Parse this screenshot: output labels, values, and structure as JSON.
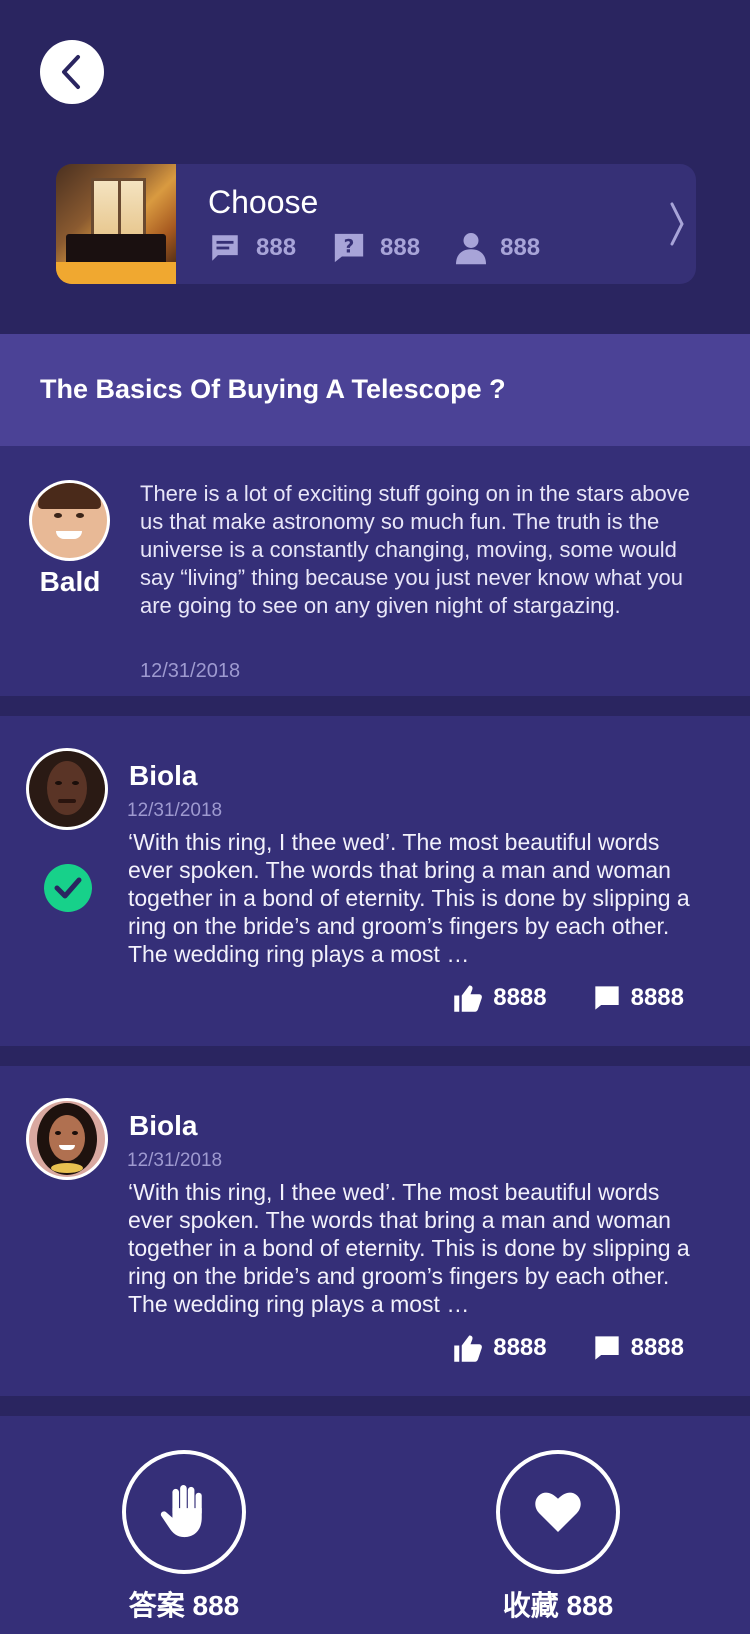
{
  "header": {
    "back_icon": "chevron-left-icon"
  },
  "group": {
    "title": "Choose",
    "stats": [
      {
        "icon": "comment-icon",
        "value": "888"
      },
      {
        "icon": "question-icon",
        "value": "888"
      },
      {
        "icon": "user-icon",
        "value": "888"
      }
    ],
    "arrow_icon": "chevron-right-icon"
  },
  "question": {
    "title": "The Basics Of Buying A Telescope ?",
    "asker": "Bald",
    "text": "There is a lot of exciting stuff going on in the stars above us that make astronomy so much fun. The truth is the universe is a constantly changing, moving, some would say “living” thing because you just never know what you are going to see on any given night of stargazing.",
    "date": "12/31/2018"
  },
  "answers": [
    {
      "name": "Biola",
      "date": "12/31/2018",
      "text": "‘With this ring, I thee wed’. The most beautiful words ever spoken. The words that bring a man and woman together in a bond of eternity. This is done by slipping a ring on the bride’s and groom’s fingers by each other.  The wedding ring plays a most …",
      "likes": "8888",
      "comments": "8888",
      "accepted": true
    },
    {
      "name": "Biola",
      "date": "12/31/2018",
      "text": "‘With this ring, I thee wed’. The most beautiful words ever spoken. The words that bring a man and woman together in a bond of eternity. This is done by slipping a ring on the bride’s and groom’s fingers by each other.  The wedding ring plays a most …",
      "likes": "8888",
      "comments": "8888",
      "accepted": false
    }
  ],
  "bottom": {
    "answer_label": "答案 888",
    "favorite_label": "收藏 888"
  },
  "colors": {
    "background": "#2a2560",
    "card": "#352f78",
    "question_bar": "#4b4296",
    "accepted_green": "#17d18a",
    "muted_text": "#9e9ad0"
  }
}
